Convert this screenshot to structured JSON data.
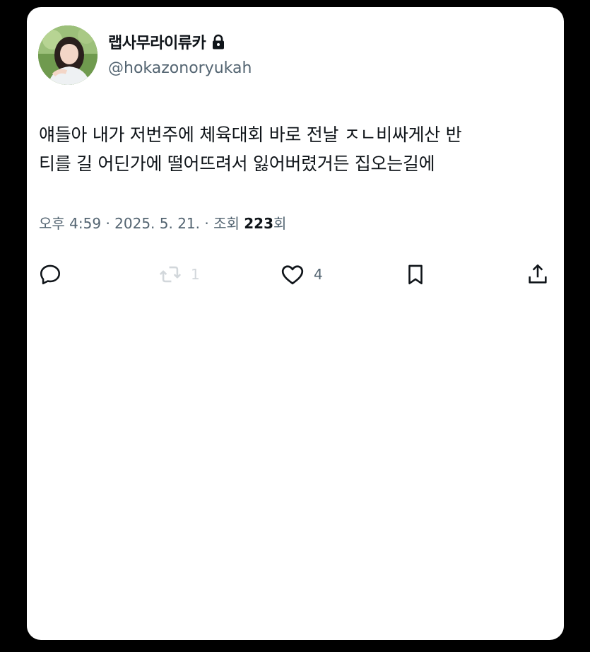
{
  "post": {
    "author": {
      "display_name": "랩사무라이류카",
      "handle": "@hokazonoryukah",
      "protected_icon": "lock-icon",
      "avatar": "profile-photo"
    },
    "text_lines": [
      "얘들아 내가 저번주에 체육대회 바로 전날 ㅈㄴ비싸게산 반",
      "티를 길 어딘가에 떨어뜨려서 잃어버렸거든 집오는길에"
    ],
    "meta": {
      "time": "오후 4:59",
      "separator": "·",
      "date": "2025. 5. 21.",
      "views_label_prefix": "조회",
      "views_count": "223",
      "views_label_suffix": "회"
    },
    "actions": {
      "reply": {
        "icon": "reply-icon",
        "count": ""
      },
      "repost": {
        "icon": "repost-icon",
        "count": "1"
      },
      "like": {
        "icon": "heart-icon",
        "count": "4"
      },
      "bookmark": {
        "icon": "bookmark-icon"
      },
      "share": {
        "icon": "share-icon"
      }
    }
  },
  "colors": {
    "background": "#000000",
    "card": "#ffffff",
    "text_primary": "#0f1419",
    "text_secondary": "#536471",
    "repost_faded": "#d2d7db"
  }
}
